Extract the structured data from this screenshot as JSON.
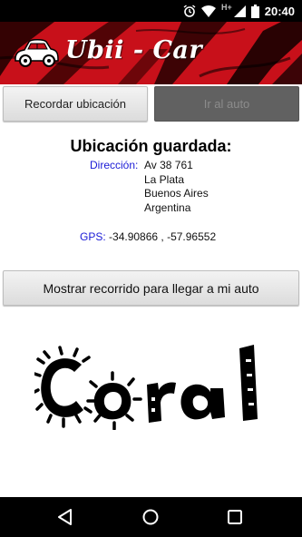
{
  "status_bar": {
    "time": "20:40",
    "network_type": "H+",
    "icons": [
      "alarm-icon",
      "wifi-icon",
      "cell-signal-icon",
      "battery-icon"
    ]
  },
  "header": {
    "app_title": "Ubii - Car",
    "logo_icon": "car-icon",
    "accent_color": "#c8101a"
  },
  "actions": {
    "record_location_label": "Recordar ubicación",
    "go_to_car_label": "Ir al auto",
    "show_route_label": "Mostrar recorrido para llegar a mi auto"
  },
  "saved_location": {
    "title": "Ubicación guardada:",
    "address_label": "Dirección:",
    "address_lines": [
      "Av 38 761",
      "La Plata",
      "Buenos Aires",
      "Argentina"
    ],
    "gps_label": "GPS:",
    "gps_value": "-34.90866 , -57.96552"
  },
  "brand_logo": {
    "text": "Coral"
  },
  "nav_bar": {
    "items": [
      "back-icon",
      "home-icon",
      "recents-icon"
    ]
  }
}
